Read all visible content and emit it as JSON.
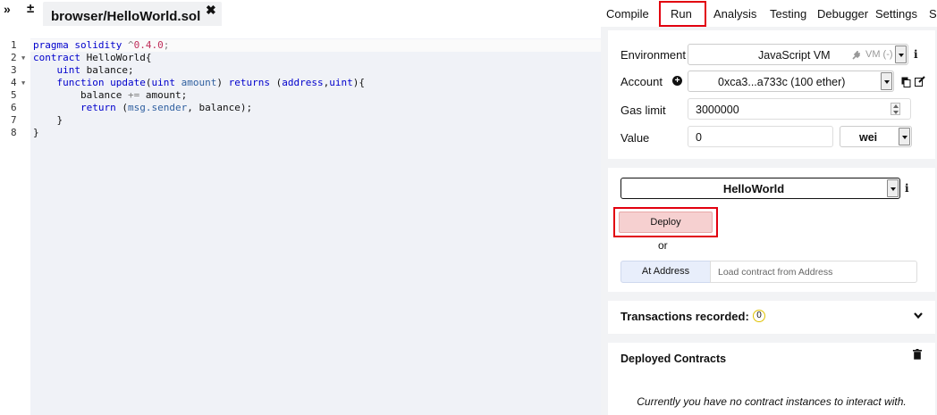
{
  "editor": {
    "file_tab": "browser/HelloWorld.sol",
    "line_numbers": [
      "1",
      "2",
      "3",
      "4",
      "5",
      "6",
      "7",
      "8"
    ]
  },
  "menu": {
    "tabs": [
      "Compile",
      "Run",
      "Analysis",
      "Testing",
      "Debugger",
      "Settings",
      "S"
    ],
    "active": "Run"
  },
  "run": {
    "environment_label": "Environment",
    "environment_value": "JavaScript VM",
    "environment_suffix": "VM (-)",
    "account_label": "Account",
    "account_value": "0xca3...a733c (100 ether)",
    "gas_limit_label": "Gas limit",
    "gas_limit_value": "3000000",
    "value_label": "Value",
    "value_value": "0",
    "value_unit": "wei",
    "contract_selected": "HelloWorld",
    "deploy_label": "Deploy",
    "or_label": "or",
    "at_address_label": "At Address",
    "at_address_placeholder": "Load contract from Address"
  },
  "transactions": {
    "title": "Transactions recorded:",
    "count": "0"
  },
  "deployed": {
    "title": "Deployed Contracts",
    "empty_message": "Currently you have no contract instances to interact with."
  },
  "icons": {
    "left_toggle": "double-chevron-right-icon",
    "new_file": "plus-icon",
    "close_tab": "close-icon",
    "plug": "plug-icon",
    "info": "info-icon",
    "add_account": "plus-circle-icon",
    "copy": "copy-icon",
    "edit": "edit-icon",
    "chevron": "chevron-down-icon",
    "trash": "trash-icon"
  },
  "colors": {
    "highlight_red": "#e2000f",
    "deploy_bg": "#f6d0d0",
    "editor_bg": "#f0f2f7"
  }
}
